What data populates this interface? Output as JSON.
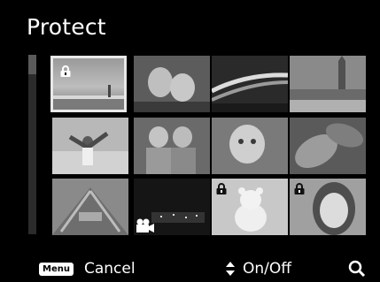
{
  "screen": {
    "title": "Protect"
  },
  "thumbnails": [
    {
      "name": "thumb-field-lake",
      "protected": true,
      "selected": true,
      "movie": false
    },
    {
      "name": "thumb-couple-portrait",
      "protected": false,
      "selected": false,
      "movie": false
    },
    {
      "name": "thumb-night-road",
      "protected": false,
      "selected": false,
      "movie": false
    },
    {
      "name": "thumb-big-ben",
      "protected": false,
      "selected": false,
      "movie": false
    },
    {
      "name": "thumb-woman-beach",
      "protected": false,
      "selected": false,
      "movie": false
    },
    {
      "name": "thumb-two-children",
      "protected": false,
      "selected": false,
      "movie": false
    },
    {
      "name": "thumb-baby",
      "protected": false,
      "selected": false,
      "movie": false
    },
    {
      "name": "thumb-leaves",
      "protected": false,
      "selected": false,
      "movie": false
    },
    {
      "name": "thumb-wooden-structure",
      "protected": false,
      "selected": false,
      "movie": false
    },
    {
      "name": "thumb-night-city",
      "protected": false,
      "selected": false,
      "movie": true
    },
    {
      "name": "thumb-teddy-bear",
      "protected": true,
      "selected": false,
      "movie": false
    },
    {
      "name": "thumb-smiling-girl",
      "protected": true,
      "selected": false,
      "movie": false
    }
  ],
  "bottom_bar": {
    "menu_key": "Menu",
    "cancel_label": "Cancel",
    "onoff_label": "On/Off"
  },
  "icons": {
    "lock": "lock-icon",
    "movie": "movie-camera-icon",
    "updown": "up-down-arrows-icon",
    "zoom": "magnifier-icon"
  }
}
